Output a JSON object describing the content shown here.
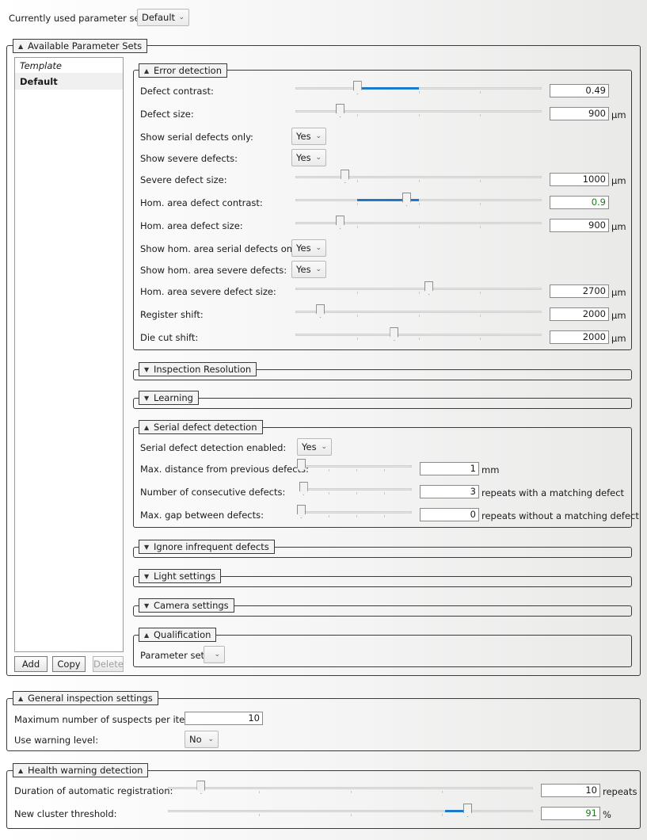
{
  "header": {
    "current_label": "Currently used parameter set:",
    "current_value": "Default"
  },
  "available_sets": {
    "title": "Available Parameter Sets",
    "items": [
      "Template",
      "Default"
    ],
    "selected": "Default",
    "add_label": "Add",
    "copy_label": "Copy",
    "delete_label": "Delete"
  },
  "error_detection": {
    "title": "Error detection",
    "defect_contrast": {
      "label": "Defect contrast:",
      "value": "0.49",
      "unit": "",
      "slider_level": 0.25,
      "range": [
        0.25,
        0.5
      ]
    },
    "defect_size": {
      "label": "Defect size:",
      "value": "900",
      "unit": "µm",
      "slider_level": 0.18
    },
    "show_serial_only": {
      "label": "Show serial defects only:",
      "value": "Yes"
    },
    "show_severe": {
      "label": "Show severe defects:",
      "value": "Yes"
    },
    "severe_defect_size": {
      "label": "Severe defect size:",
      "value": "1000",
      "unit": "µm",
      "slider_level": 0.2
    },
    "hom_contrast": {
      "label": "Hom. area defect contrast:",
      "value": "0.9",
      "unit": "",
      "slider_level": 0.45,
      "range": [
        0.25,
        0.5
      ]
    },
    "hom_size": {
      "label": "Hom. area defect size:",
      "value": "900",
      "unit": "µm",
      "slider_level": 0.18
    },
    "hom_serial_only": {
      "label": "Show hom. area serial defects only:",
      "value": "Yes"
    },
    "hom_severe": {
      "label": "Show hom. area severe defects:",
      "value": "Yes"
    },
    "hom_severe_size": {
      "label": "Hom. area severe defect size:",
      "value": "2700",
      "unit": "µm",
      "slider_level": 0.54
    },
    "register_shift": {
      "label": "Register shift:",
      "value": "2000",
      "unit": "µm",
      "slider_level": 0.1
    },
    "die_cut_shift": {
      "label": "Die cut shift:",
      "value": "2000",
      "unit": "µm",
      "slider_level": 0.4
    }
  },
  "collapsed_sections": {
    "inspection_resolution": "Inspection Resolution",
    "learning": "Learning",
    "ignore_infrequent": "Ignore infrequent defects",
    "light_settings": "Light settings",
    "camera_settings": "Camera settings"
  },
  "serial_detection": {
    "title": "Serial defect detection",
    "enabled": {
      "label": "Serial defect detection enabled:",
      "value": "Yes"
    },
    "max_distance": {
      "label": "Max. distance from previous defects:",
      "value": "1",
      "unit": "mm",
      "slider_level": 0.0
    },
    "consecutive": {
      "label": "Number of consecutive defects:",
      "value": "3",
      "unit": "repeats with a matching defect",
      "slider_level": 0.02
    },
    "max_gap": {
      "label": "Max. gap between defects:",
      "value": "0",
      "unit": "repeats without a matching defect",
      "slider_level": 0.0
    }
  },
  "qualification": {
    "title": "Qualification",
    "parameter_set_label": "Parameter set:",
    "parameter_set_value": ""
  },
  "general": {
    "title": "General inspection settings",
    "max_suspects_label": "Maximum number of suspects per item:",
    "max_suspects_value": "10",
    "warning_label": "Use warning level:",
    "warning_value": "No"
  },
  "health": {
    "title": "Health warning detection",
    "duration_label": "Duration of automatic registration:",
    "duration_value": "10",
    "duration_unit": "repeats",
    "duration_level": 0.09,
    "cluster_label": "New cluster threshold:",
    "cluster_value": "91",
    "cluster_unit": "%",
    "cluster_level": 0.82
  },
  "colors": {
    "slider_range": "#1f78c8",
    "accent_green": "#1f7a1f"
  },
  "icons": {
    "expanded": "triangle-up-icon",
    "collapsed": "triangle-down-icon",
    "dropdown": "chevron-down-icon"
  }
}
